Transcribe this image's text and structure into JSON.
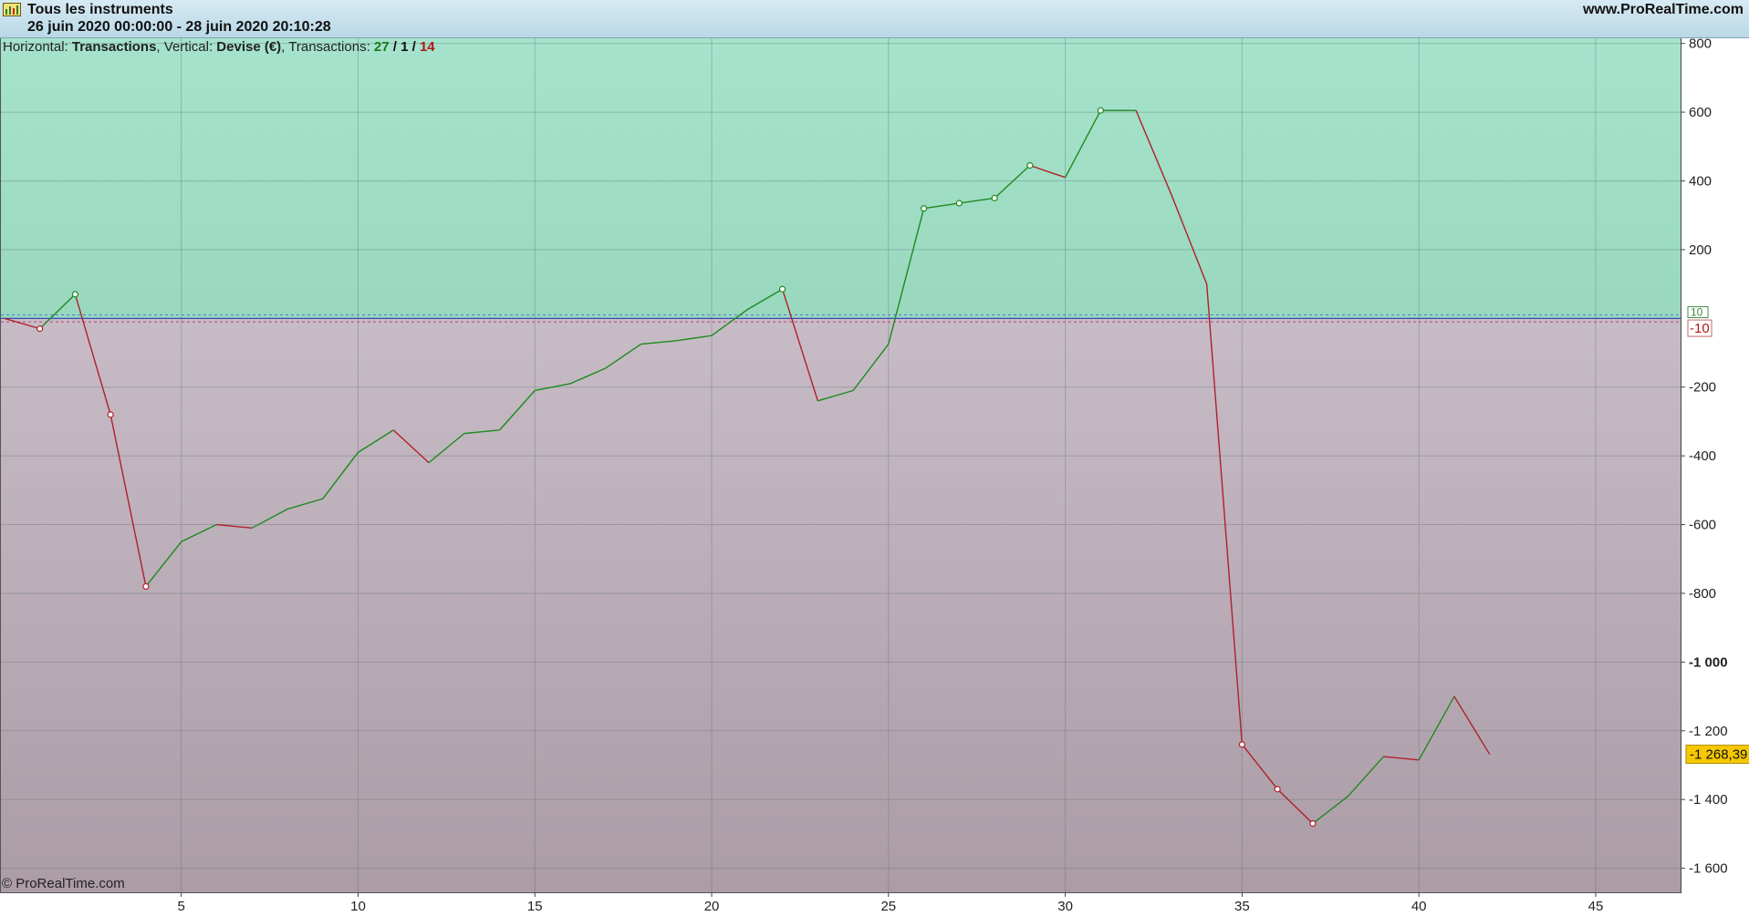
{
  "header": {
    "title": "Tous les instruments",
    "date_range": "26 juin 2020 00:00:00 - 28 juin 2020 20:10:28",
    "site": "www.ProRealTime.com"
  },
  "info": {
    "h_label": "Horizontal:",
    "h_value": "Transactions",
    "v_label": "Vertical:",
    "v_value": "Devise (€)",
    "t_label": "Transactions:",
    "wins": "27",
    "sep": "/",
    "neutral": "1",
    "losses": "14"
  },
  "copyright": "© ProRealTime.com",
  "colors": {
    "profit_line": "#1e8a1e",
    "loss_line": "#b0202a",
    "positive_zone": "#a6e3cc",
    "negative_zone": "#b3a3ad",
    "current_badge": "#f5c800"
  },
  "chart_data": {
    "type": "line",
    "x": [
      0,
      1,
      2,
      3,
      4,
      5,
      6,
      7,
      8,
      9,
      10,
      11,
      12,
      13,
      14,
      15,
      16,
      17,
      18,
      19,
      20,
      21,
      22,
      23,
      24,
      25,
      26,
      27,
      28,
      29,
      30,
      31,
      32,
      33,
      34,
      35,
      36,
      37,
      38,
      39,
      40,
      41,
      42
    ],
    "y": [
      0,
      -30,
      70,
      -280,
      -780,
      -650,
      -600,
      -610,
      -555,
      -525,
      -390,
      -325,
      -420,
      -335,
      -325,
      -210,
      -190,
      -145,
      -75,
      -65,
      -50,
      25,
      85,
      -240,
      -210,
      -75,
      320,
      335,
      350,
      445,
      410,
      605,
      605,
      360,
      100,
      -1240,
      -1370,
      -1470,
      -1390,
      -1275,
      -1285,
      -1100,
      -1268.39
    ],
    "markers_at": [
      1,
      2,
      3,
      4,
      22,
      26,
      27,
      28,
      29,
      31,
      35,
      36,
      37
    ],
    "xlim": [
      -0.1,
      47.4
    ],
    "ylim": [
      -1670,
      815
    ],
    "x_ticks": [
      "5",
      "10",
      "15",
      "20",
      "25",
      "30",
      "35",
      "40",
      "45"
    ],
    "y_ticks": [
      "800",
      "600",
      "400",
      "200",
      "-200",
      "-400",
      "-600",
      "-800",
      "-1 000",
      "-1 200",
      "-1 400",
      "-1 600"
    ],
    "reference_labels": [
      "10",
      "-10"
    ],
    "current_value_label": "-1 268,39",
    "grid": true
  }
}
